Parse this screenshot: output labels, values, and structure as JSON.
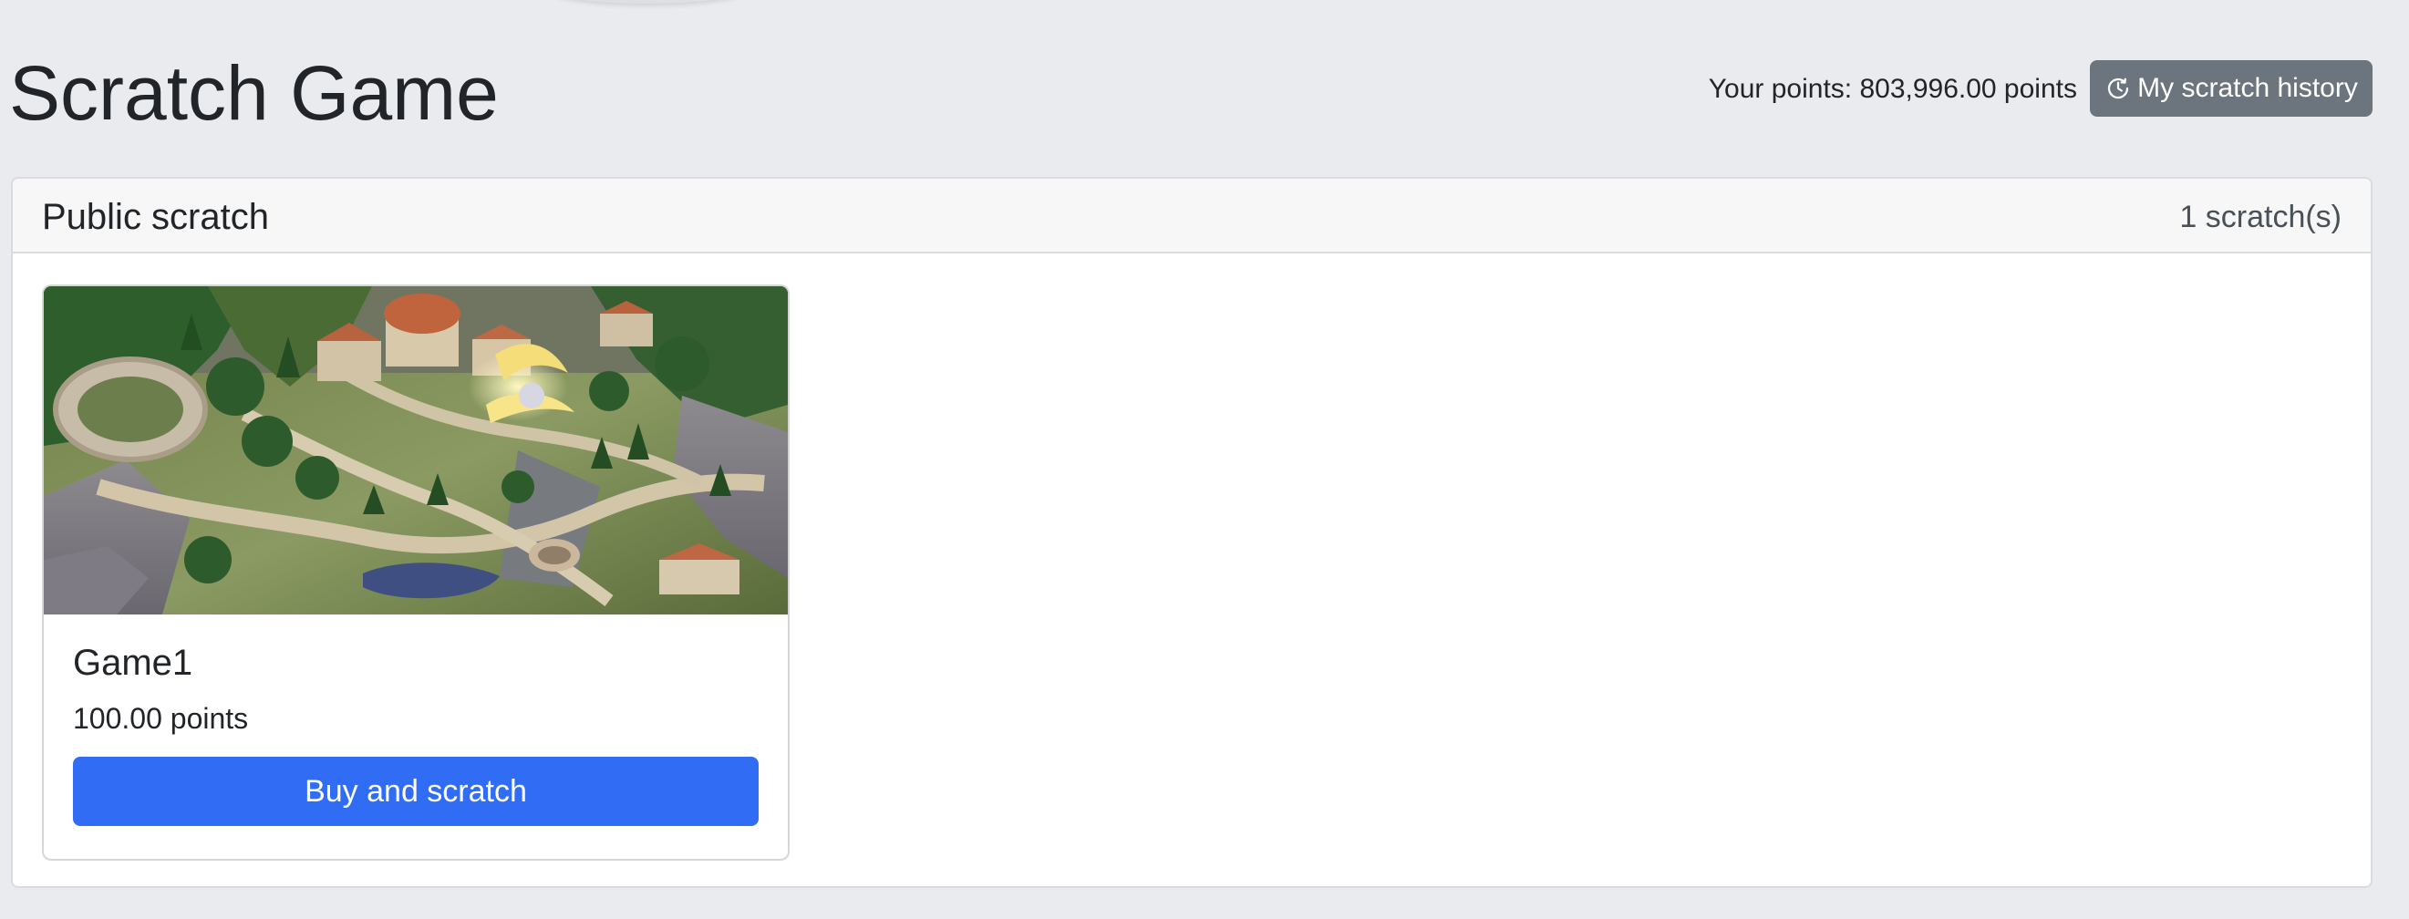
{
  "header": {
    "title": "Scratch Game",
    "points_text": "Your points: 803,996.00 points",
    "history_button_label": "My scratch history",
    "history_icon": "clock-history-icon"
  },
  "panel": {
    "title": "Public scratch",
    "count": "1 scratch(s)"
  },
  "cards": [
    {
      "title": "Game1",
      "price": "100.00 points",
      "button_label": "Buy and scratch",
      "image": "fantasy-city-landscape"
    }
  ],
  "colors": {
    "page_background": "#e9ebef",
    "primary_button": "#316cf4",
    "secondary_button": "#6c757d"
  }
}
